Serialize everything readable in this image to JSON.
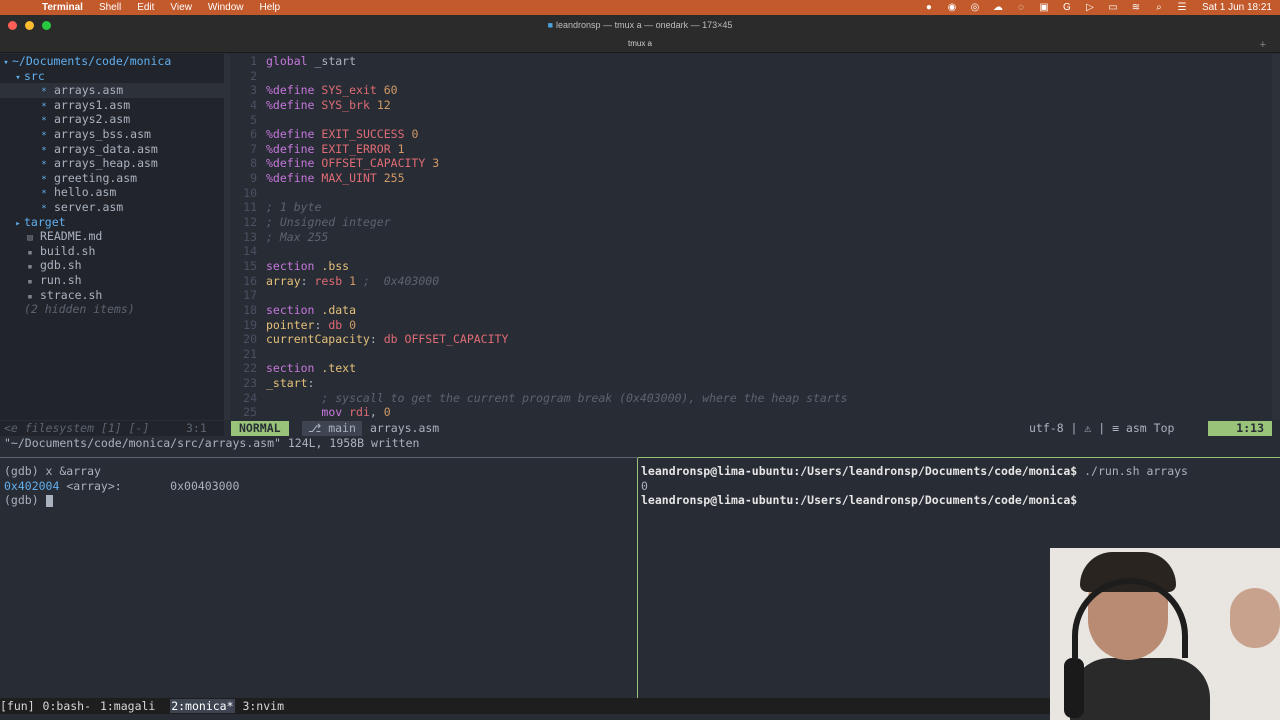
{
  "menubar": {
    "items": [
      "Terminal",
      "Shell",
      "Edit",
      "View",
      "Window",
      "Help"
    ],
    "clock": "Sat 1 Jun  18:21"
  },
  "window": {
    "title": "leandronsp — tmux a — onedark — 173×45",
    "tab": "tmux a"
  },
  "tree": {
    "root": "~/Documents/code/monica",
    "src_dir": "src",
    "src_files": [
      "arrays.asm",
      "arrays1.asm",
      "arrays2.asm",
      "arrays_bss.asm",
      "arrays_data.asm",
      "arrays_heap.asm",
      "greeting.asm",
      "hello.asm",
      "server.asm"
    ],
    "target_dir": "target",
    "files": [
      "README.md",
      "build.sh",
      "gdb.sh",
      "run.sh",
      "strace.sh"
    ],
    "hidden": "(2 hidden items)"
  },
  "code": {
    "lines": [
      "global _start",
      "",
      "%define SYS_exit 60",
      "%define SYS_brk 12",
      "",
      "%define EXIT_SUCCESS 0",
      "%define EXIT_ERROR 1",
      "%define OFFSET_CAPACITY 3",
      "%define MAX_UINT 255",
      "",
      "; 1 byte",
      "; Unsigned integer",
      "; Max 255",
      "",
      "section .bss",
      "array: resb 1 ;  0x403000",
      "",
      "section .data",
      "pointer: db 0",
      "currentCapacity: db OFFSET_CAPACITY",
      "",
      "section .text",
      "_start:",
      "        ; syscall to get the current program break (0x403000), where the heap starts",
      "        mov rdi, 0"
    ]
  },
  "status": {
    "tree": "<e filesystem [1] [-]",
    "tree_pos": "3:1",
    "mode": "NORMAL",
    "branch": "main",
    "file": "arrays.asm",
    "encoding": "utf-8  |  ⚠  |  ≡ asm",
    "scroll": "Top",
    "pos": "1:13"
  },
  "cmdline": "\"~/Documents/code/monica/src/arrays.asm\" 124L, 1958B written",
  "gdb": {
    "line1": "(gdb) x &array",
    "addr": "0x402004",
    "rest": " <array>:       0x00403000",
    "prompt": "(gdb) "
  },
  "shell": {
    "user": "leandronsp@lima-ubuntu",
    "path": ":/Users/leandronsp/Documents/code/monica$",
    "cmd": " ./run.sh arrays",
    "output": "0"
  },
  "tmux": {
    "session": "[fun] ",
    "windows": [
      "0:bash-",
      "1:magali",
      "2:monica*",
      "3:nvim"
    ]
  }
}
